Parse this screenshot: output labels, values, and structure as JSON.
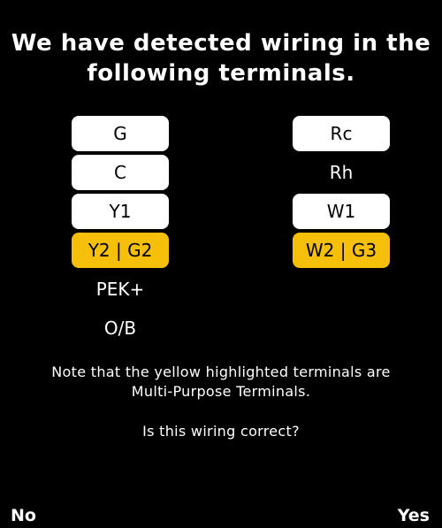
{
  "title": {
    "line1": "We have detected wiring in the",
    "line2": "following terminals."
  },
  "terminals": {
    "left": [
      {
        "label": "G",
        "state": "detected"
      },
      {
        "label": "C",
        "state": "detected"
      },
      {
        "label": "Y1",
        "state": "detected"
      },
      {
        "label": "Y2 | G2",
        "state": "multi-purpose"
      },
      {
        "label": "PEK+",
        "state": "not-detected"
      },
      {
        "label": "O/B",
        "state": "not-detected"
      }
    ],
    "right": [
      {
        "label": "Rc",
        "state": "detected"
      },
      {
        "label": "Rh",
        "state": "not-detected"
      },
      {
        "label": "W1",
        "state": "detected"
      },
      {
        "label": "W2 | G3",
        "state": "multi-purpose"
      }
    ]
  },
  "note": {
    "line1": "Note that the yellow highlighted terminals are",
    "line2": "Multi-Purpose Terminals."
  },
  "question": "Is this wiring correct?",
  "buttons": {
    "no": "No",
    "yes": "Yes"
  },
  "colors": {
    "background": "#000000",
    "detected": "#ffffff",
    "multi_purpose": "#f5bf0a",
    "text": "#ffffff"
  }
}
